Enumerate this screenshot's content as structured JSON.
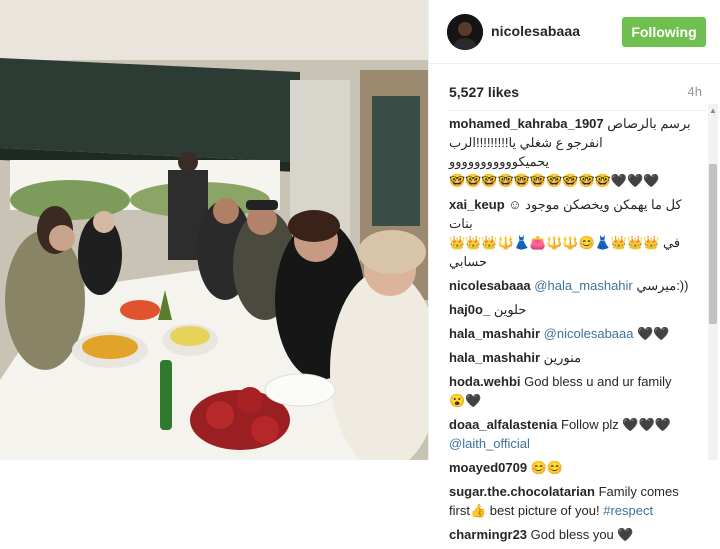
{
  "post": {
    "photo_icon": "family-dinner-photo",
    "username": "nicolesabaaa",
    "follow_label": "Following",
    "likes": "5,527 likes",
    "time_ago": "4h",
    "follow_color": "#70c050",
    "link_color": "#3f729b"
  },
  "comments": [
    {
      "user": "mohamed_kahraba_1907",
      "text": "برسم بالرصاص",
      "text2": "انفرجو ع شغلي يا!!!!!!!!!الرب يحميكووووووووووو",
      "text3": "🤓🤓🤓🤓🤓🤓🤓🤓🤓🤓🖤🖤🖤"
    },
    {
      "user": "xai_keup",
      "text": "كل ما يهمكن ويخصكن موجود ☺ بنات",
      "text2": "👑👑👑🔱👗👛🔱🔱😊👗👑👑👑 في حسابي"
    },
    {
      "user": "nicolesabaaa",
      "mention": "@hala_mashahir",
      "text": "ميرسي:))"
    },
    {
      "user": "haj0o_",
      "text": "حلوين"
    },
    {
      "user": "hala_mashahir",
      "mention": "@nicolesabaaa",
      "text": "🖤🖤"
    },
    {
      "user": "hala_mashahir",
      "text": "منورين"
    },
    {
      "user": "hoda.wehbi",
      "text": "God bless u and ur family",
      "text2": "😮🖤"
    },
    {
      "user": "doaa_alfalastenia",
      "text": "Follow plz 🖤🖤🖤",
      "mention": "@laith_official"
    },
    {
      "user": "moayed0709",
      "text": "😊😊"
    },
    {
      "user": "sugar.the.chocolatarian",
      "text": "Family comes first👍 best picture of you!",
      "hashtag": "#respect"
    },
    {
      "user": "charmingr23",
      "text": "God bless you 🖤"
    }
  ]
}
